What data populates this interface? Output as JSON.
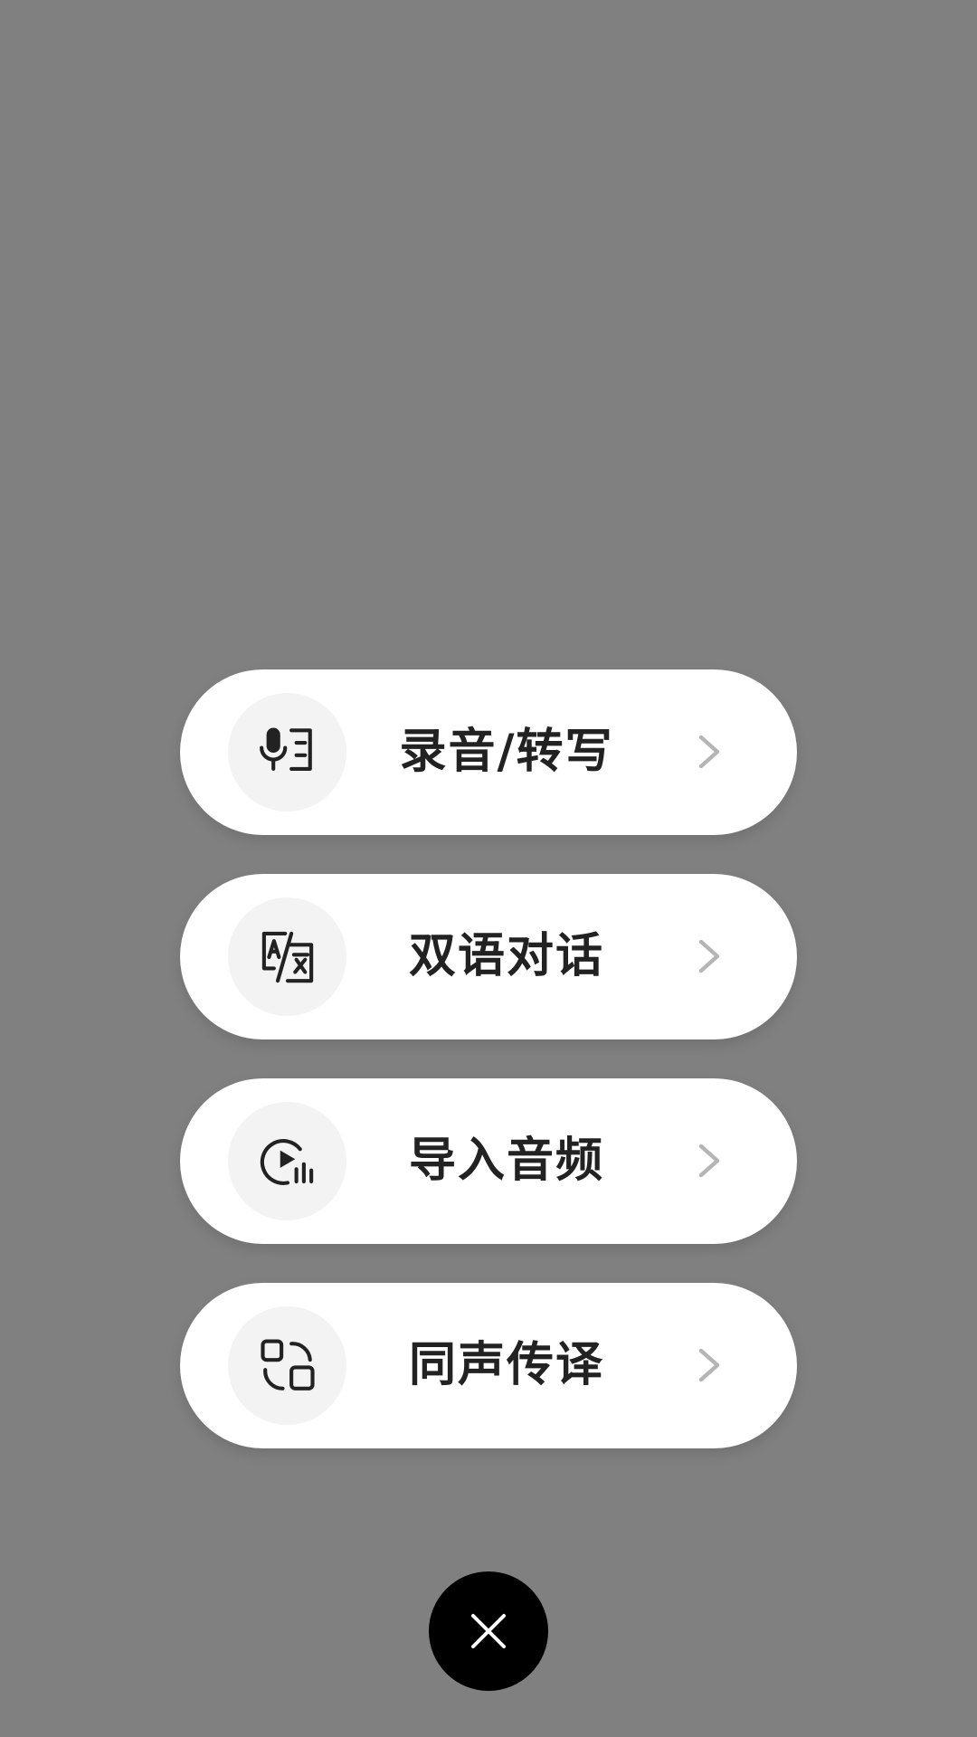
{
  "menu": {
    "items": [
      {
        "label": "录音/转写",
        "icon": "mic-transcribe-icon"
      },
      {
        "label": "双语对话",
        "icon": "translate-icon"
      },
      {
        "label": "导入音频",
        "icon": "import-audio-icon"
      },
      {
        "label": "同声传译",
        "icon": "simultaneous-interpretation-icon"
      }
    ]
  },
  "close": {
    "icon": "close-icon"
  },
  "colors": {
    "overlay": "#808080",
    "pill": "#ffffff",
    "icon_bg": "#f3f3f3",
    "text": "#222222",
    "chevron": "#b5b5b5",
    "close_bg": "#000000"
  }
}
